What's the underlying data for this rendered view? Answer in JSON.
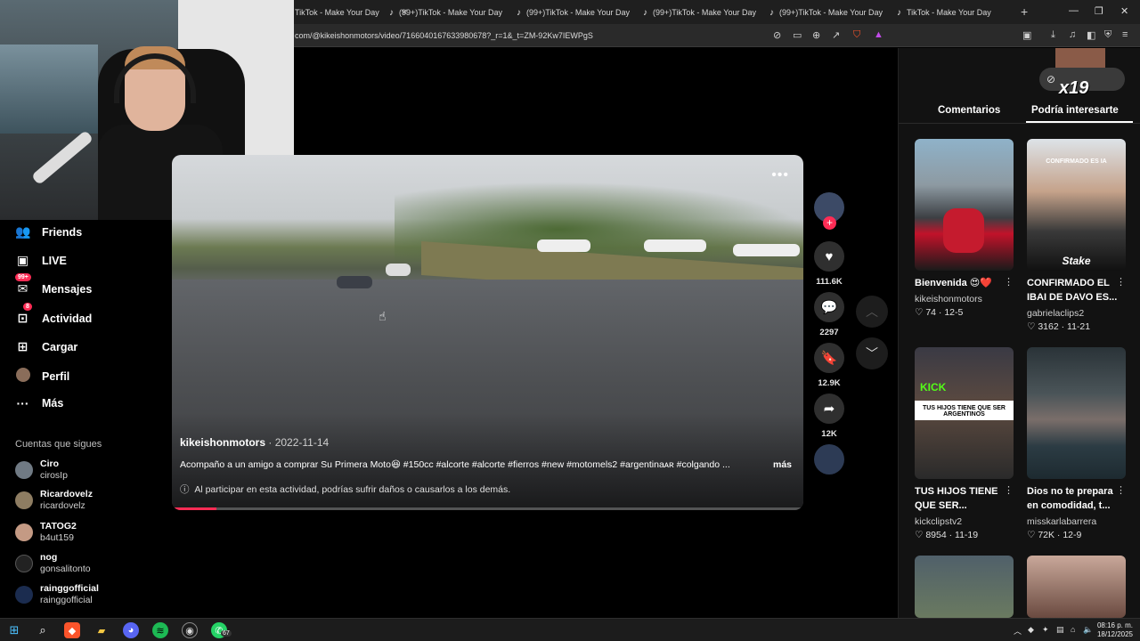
{
  "browser": {
    "tabs": [
      {
        "label": "TikTok - Make Your Day"
      },
      {
        "label": "(99+)TikTok - Make Your Day"
      },
      {
        "label": "(99+)TikTok - Make Your Day"
      },
      {
        "label": "(99+)TikTok - Make Your Day"
      },
      {
        "label": "(99+)TikTok - Make Your Day"
      },
      {
        "label": "TikTok - Make Your Day"
      }
    ],
    "url": "com/@kikeishonmotors/video/7166040167633980678?_r=1&_t=ZM-92Kw7IEWPgS"
  },
  "sidebar": {
    "items": [
      {
        "label": "Friends",
        "icon": "friends-icon"
      },
      {
        "label": "LIVE",
        "icon": "live-icon"
      },
      {
        "label": "Mensajes",
        "icon": "messages-icon",
        "badge": "99+"
      },
      {
        "label": "Actividad",
        "icon": "activity-icon",
        "badge": "8"
      },
      {
        "label": "Cargar",
        "icon": "upload-icon"
      },
      {
        "label": "Perfil",
        "icon": "avatar"
      },
      {
        "label": "Más",
        "icon": "more-icon"
      }
    ],
    "following_title": "Cuentas que sigues",
    "following": [
      {
        "name": "Ciro",
        "user": "cirosIp"
      },
      {
        "name": "Ricardovelz",
        "user": "ricardovelz"
      },
      {
        "name": "TATOG2",
        "user": "b4ut159"
      },
      {
        "name": "nog",
        "user": "gonsalitonto"
      },
      {
        "name": "rainggofficial",
        "user": "rainggofficial"
      }
    ]
  },
  "video": {
    "author": "kikeishonmotors",
    "date": "· 2022-11-14",
    "description": "Acompaño a un amigo a comprar Su Primera Moto😆 #150cc #alcorte #alcorte #fierros #new #motomels2 #argentinaᴀʀ #colgando ...",
    "more_label": "más",
    "warning": "Al participar en esta actividad, podrías sufrir daños o causarlos a los demás.",
    "progress": 0.07
  },
  "actions": {
    "likes": "111.6K",
    "comments": "2297",
    "saves": "12.9K",
    "shares": "12K"
  },
  "right_panel": {
    "overlay_badge": "x19",
    "tabs": [
      {
        "label": "Comentarios"
      },
      {
        "label": "Podría interesarte"
      }
    ],
    "cards": [
      {
        "title": "Bienvenida 😍❤️",
        "user": "kikeishonmotors",
        "stats": "♡ 74 · 12-5",
        "thumb_text": ""
      },
      {
        "title": "CONFIRMADO EL IBAI DE DAVO ES...",
        "user": "gabrielaclips2",
        "stats": "♡ 3162 · 11-21",
        "thumb_text": "CONFIRMADO ES IA"
      },
      {
        "title": "TUS HIJOS TIENE QUE SER...",
        "user": "kickclipstv2",
        "stats": "♡ 8954 · 11-19",
        "thumb_text": "TUS HIJOS TIENE QUE SER ARGENTINOS"
      },
      {
        "title": "Dios no te prepara en comodidad, t...",
        "user": "misskarlabarrera",
        "stats": "♡ 72K · 12-9",
        "thumb_text": ""
      }
    ]
  },
  "taskbar": {
    "time": "08:16 p. m.",
    "date": "18/12/2025",
    "whatsapp_badge": "67"
  }
}
